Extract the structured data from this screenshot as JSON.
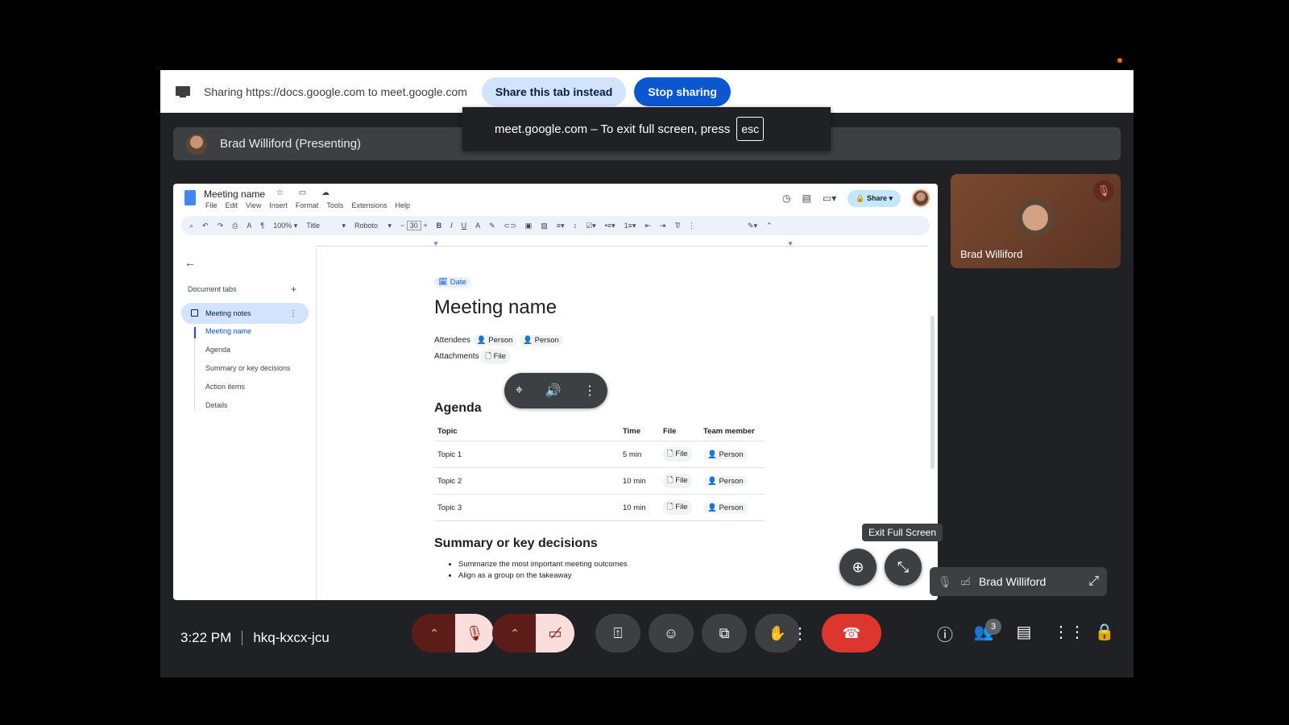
{
  "share_bar": {
    "text": "Sharing https://docs.google.com to meet.google.com",
    "share_tab_label": "Share this tab instead",
    "stop_label": "Stop sharing"
  },
  "fullscreen_toast": {
    "text": "meet.google.com – To exit full screen, press",
    "key": "esc"
  },
  "presenter": {
    "label": "Brad Williford (Presenting)"
  },
  "doc": {
    "title": "Meeting name",
    "menus": [
      "File",
      "Edit",
      "View",
      "Insert",
      "Format",
      "Tools",
      "Extensions",
      "Help"
    ],
    "share_label": "Share",
    "toolbar": {
      "zoom": "100%",
      "style": "Title",
      "font": "Roboto",
      "size": "30"
    },
    "sidebar": {
      "heading": "Document tabs",
      "active_tab": "Meeting notes",
      "outline": [
        "Meeting name",
        "Agenda",
        "Summary or key decisions",
        "Action items",
        "Details"
      ]
    },
    "page": {
      "date_chip": "Date",
      "title": "Meeting name",
      "attendees_label": "Attendees",
      "attendee_chips": [
        "Person",
        "Person"
      ],
      "attachments_label": "Attachments",
      "attachment_chip": "File",
      "agenda_heading": "Agenda",
      "agenda_columns": [
        "Topic",
        "Time",
        "File",
        "Team member"
      ],
      "agenda_rows": [
        {
          "topic": "Topic 1",
          "time": "5 min",
          "file": "File",
          "member": "Person"
        },
        {
          "topic": "Topic 2",
          "time": "10 min",
          "file": "File",
          "member": "Person"
        },
        {
          "topic": "Topic 3",
          "time": "10 min",
          "file": "File",
          "member": "Person"
        }
      ],
      "summary_heading": "Summary or key decisions",
      "summary_items": [
        "Summarize the most important meeting outcomes",
        "Align as a group on the takeaway"
      ]
    }
  },
  "tooltip": "Exit Full Screen",
  "self_tile": {
    "name": "Brad Williford"
  },
  "pip": {
    "name": "Brad Williford"
  },
  "bottom": {
    "time": "3:22 PM",
    "meeting_code": "hkq-kxcx-jcu",
    "participants_count": "3"
  },
  "colors": {
    "end_call": "#dc362e",
    "primary": "#0b57d0",
    "muted_bg": "#f9dedc"
  }
}
